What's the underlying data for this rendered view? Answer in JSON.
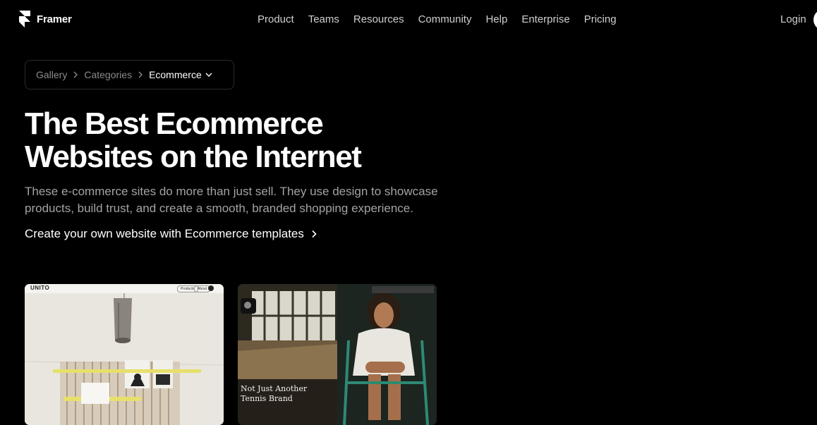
{
  "nav": {
    "brand": "Framer",
    "links": [
      "Product",
      "Teams",
      "Resources",
      "Community",
      "Help",
      "Enterprise",
      "Pricing"
    ],
    "login": "Login"
  },
  "breadcrumb": {
    "items": [
      "Gallery",
      "Categories"
    ],
    "current": "Ecommerce"
  },
  "hero": {
    "title_line1": "The Best Ecommerce",
    "title_line2": "Websites on the Internet",
    "subtitle": "These e-commerce sites do more than just sell. They use design to showcase products, build trust, and create a smooth, branded shopping experience.",
    "cta": "Create your own website with Ecommerce templates"
  },
  "cards": [
    {
      "brand": "UNITO",
      "nav_items": [
        "Products",
        "About"
      ]
    },
    {
      "caption_line1": "Not Just Another",
      "caption_line2": "Tennis Brand"
    }
  ],
  "colors": {
    "background": "#000000",
    "text": "#ffffff",
    "muted": "#8a8a8a",
    "subtitle": "#a3a3a3"
  }
}
